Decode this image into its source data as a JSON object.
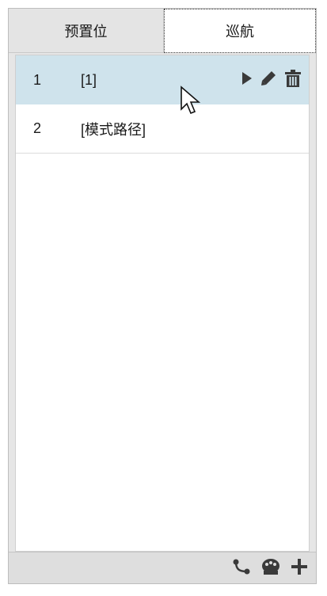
{
  "tabs": [
    {
      "label": "预置位"
    },
    {
      "label": "巡航"
    }
  ],
  "rows": [
    {
      "num": "1",
      "name": "[1]"
    },
    {
      "num": "2",
      "name": "[模式路径]"
    }
  ],
  "row_actions": [
    "play-icon",
    "pencil-icon",
    "trash-icon"
  ],
  "footer_icons": [
    "path-icon",
    "palette-icon",
    "plus-icon"
  ],
  "colors": {
    "selected_row": "#cfe3ec",
    "icon": "#3a3a3a"
  }
}
